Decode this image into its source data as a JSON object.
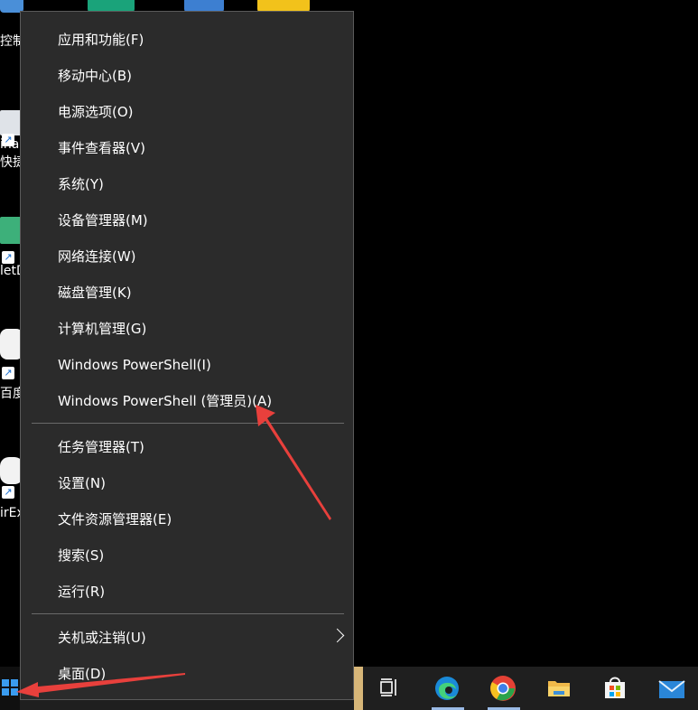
{
  "desktop": {
    "icons": [
      {
        "label": "控制",
        "color": "#4a8fd8"
      },
      {
        "label": "ina",
        "color": "#dfe3e8"
      },
      {
        "label": "快捷",
        "color": "#dfe3e8"
      },
      {
        "label": "letD",
        "color": "#3db07a"
      },
      {
        "label": "百度",
        "color": "#f2f2f2"
      },
      {
        "label": "irEx",
        "color": "#f2f2f2"
      }
    ]
  },
  "menu": {
    "group1": [
      "应用和功能(F)",
      "移动中心(B)",
      "电源选项(O)",
      "事件查看器(V)",
      "系统(Y)",
      "设备管理器(M)",
      "网络连接(W)",
      "磁盘管理(K)",
      "计算机管理(G)",
      "Windows PowerShell(I)",
      "Windows PowerShell (管理员)(A)"
    ],
    "group2": [
      "任务管理器(T)",
      "设置(N)",
      "文件资源管理器(E)",
      "搜索(S)",
      "运行(R)"
    ],
    "group3": [
      "关机或注销(U)",
      "桌面(D)"
    ]
  },
  "taskbar": {
    "icons": [
      "task-view-icon",
      "edge-icon",
      "chrome-icon",
      "file-explorer-icon",
      "store-icon",
      "mail-icon"
    ]
  },
  "colors": {
    "menu_bg": "#2b2b2b",
    "annotation_arrow": "#e8403c",
    "accent": "#3a9cf0"
  }
}
